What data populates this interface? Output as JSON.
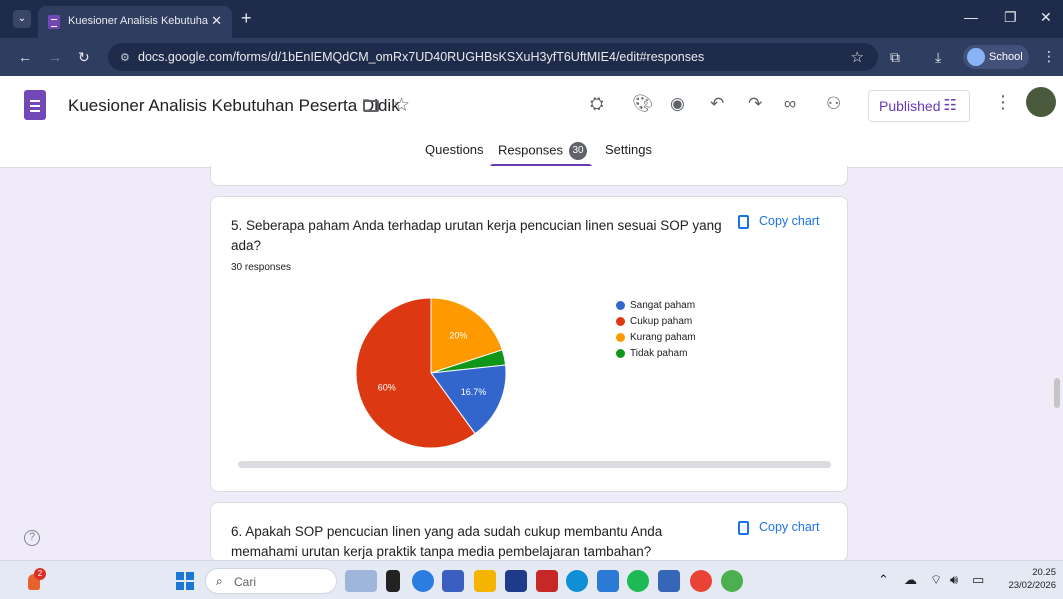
{
  "browser": {
    "tab_title": "Kuesioner Analisis Kebutuhan P",
    "url": "docs.google.com/forms/d/1bEnIEMQdCM_omRx7UD40RUGHBsKSXuH3yfT6UftMIE4/edit#responses",
    "profile_label": "School"
  },
  "form": {
    "title": "Kuesioner Analisis Kebutuhan Peserta Didik",
    "published_label": "Published",
    "tabs": [
      {
        "label": "Questions"
      },
      {
        "label": "Responses",
        "badge": "30"
      },
      {
        "label": "Settings"
      }
    ]
  },
  "questions": [
    {
      "title": "5. Seberapa paham Anda terhadap urutan kerja pencucian linen sesuai SOP yang ada?",
      "responses": "30 responses",
      "copy_label": "Copy chart"
    },
    {
      "title": "6. Apakah SOP pencucian linen yang ada sudah cukup membantu Anda memahami urutan kerja praktik tanpa media pembelajaran tambahan?",
      "copy_label": "Copy chart"
    }
  ],
  "chart_data": {
    "type": "pie",
    "categories": [
      "Sangat paham",
      "Cukup paham",
      "Kurang paham",
      "Tidak paham"
    ],
    "values": [
      16.7,
      60,
      20,
      3.3
    ],
    "labels": [
      "16.7%",
      "60%",
      "20%",
      ""
    ],
    "colors": [
      "#3366cc",
      "#dc3912",
      "#ff9900",
      "#109618"
    ],
    "legend": "right"
  },
  "taskbar": {
    "search_label": "Cari",
    "time": "20.25",
    "date": "23/02/2026",
    "weather_badge": "2"
  }
}
